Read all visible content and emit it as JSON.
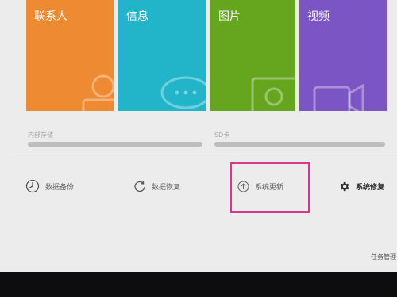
{
  "tiles": [
    {
      "label": "联系人",
      "color": "#ee8a31",
      "icon": "contact-icon"
    },
    {
      "label": "信息",
      "color": "#22b5c9",
      "icon": "message-icon"
    },
    {
      "label": "图片",
      "color": "#66a61f",
      "icon": "image-icon"
    },
    {
      "label": "视频",
      "color": "#7b55c3",
      "icon": "video-icon"
    }
  ],
  "storage": {
    "internal": {
      "label": "内部存储",
      "used_fraction": 1.0
    },
    "sd": {
      "label": "SD卡",
      "used_fraction": 1.0
    }
  },
  "actions": [
    {
      "label": "数据备份",
      "icon": "backup-clock-icon"
    },
    {
      "label": "数据恢复",
      "icon": "restore-icon"
    },
    {
      "label": "系统更新",
      "icon": "update-arrow-icon"
    },
    {
      "label": "系统修复",
      "icon": "gear-icon"
    }
  ],
  "highlight_color": "#d8388a",
  "taskbar": {
    "text": "任务管理"
  }
}
